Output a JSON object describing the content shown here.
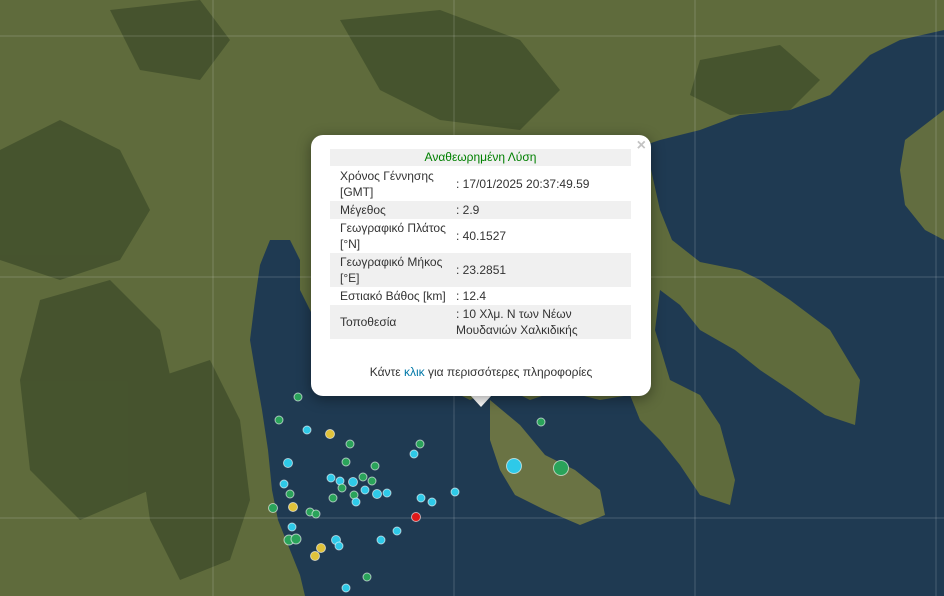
{
  "popup": {
    "title": "Αναθεωρημένη Λύση",
    "close_symbol": "×",
    "rows": [
      {
        "label": "Χρόνος Γέννησης [GMT]",
        "value": ": 17/01/2025 20:37:49.59"
      },
      {
        "label": "Μέγεθος",
        "value": ": 2.9"
      },
      {
        "label": "Γεωγραφικό Πλάτος [°N]",
        "value": ": 40.1527"
      },
      {
        "label": "Γεωγραφικό Μήκος [°E]",
        "value": ": 23.2851"
      },
      {
        "label": "Εστιακό Βάθος [km]",
        "value": ": 12.4"
      },
      {
        "label": "Τοποθεσία",
        "value": ": 10 Χλμ. Ν των Νέων Μουδανιών Χαλκιδικής"
      }
    ],
    "more_prefix": "Κάντε ",
    "more_link": "κλικ",
    "more_suffix": " για περισσότερες πληροφορίες"
  },
  "colors": {
    "sea": "#1f3a52",
    "land": "#5f6b3c",
    "mountain": "#3e4c2a",
    "marker_cyan": "#2ec9e8",
    "marker_green": "#2aa35a",
    "marker_yellow": "#e0c23a",
    "marker_red": "#e01919",
    "title_green": "#008000",
    "link_blue": "#0078a8"
  }
}
